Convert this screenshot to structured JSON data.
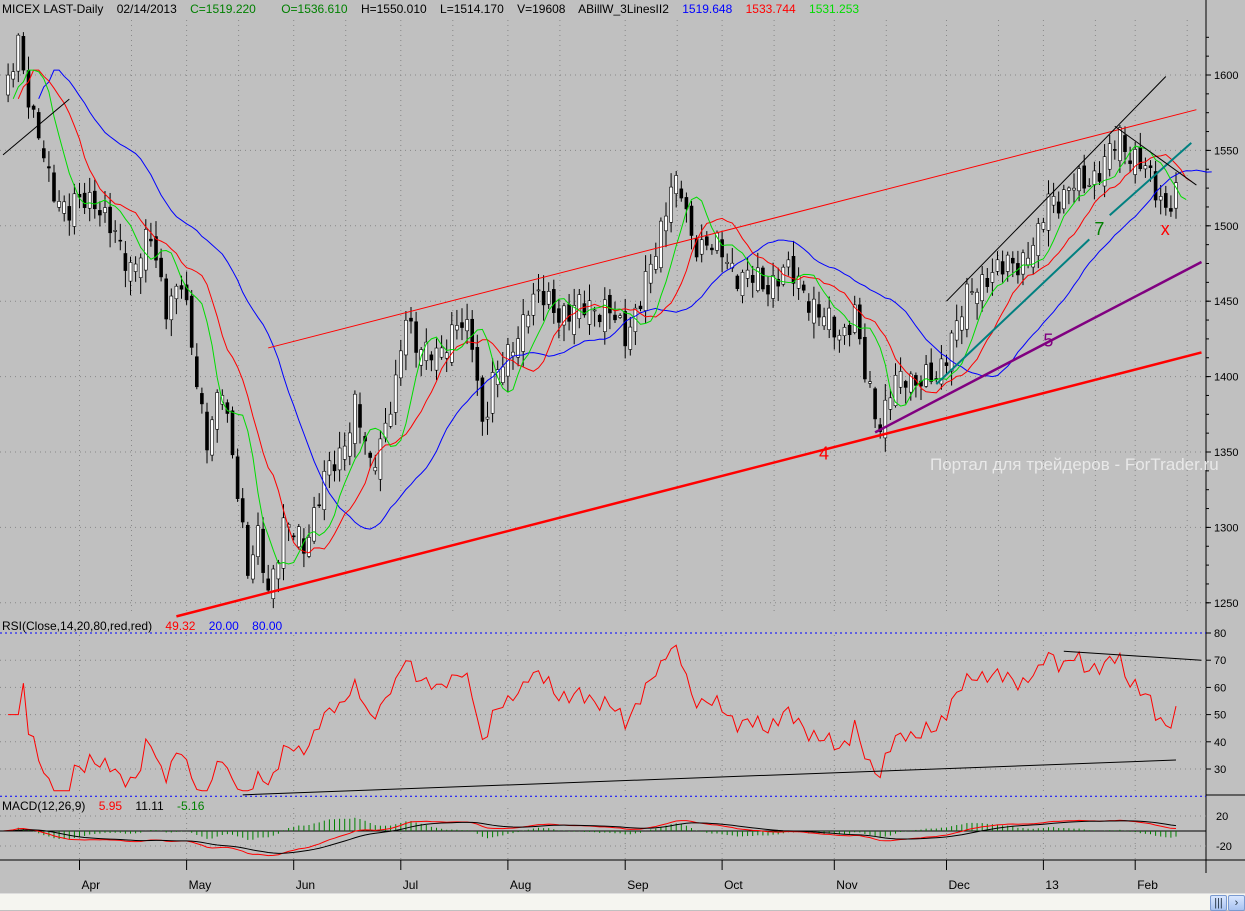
{
  "header": {
    "symbol": "MICEX LAST-Daily",
    "date": "02/14/2013",
    "close": "C=1519.220",
    "open": "O=1536.610",
    "high": "H=1550.010",
    "low": "L=1514.170",
    "volume": "V=19608",
    "indicator": "ABillW_3LinesII2",
    "line_blue": "1519.648",
    "line_red": "1533.744",
    "line_green": "1531.253"
  },
  "rsi_header": {
    "label": "RSI(Close,14,20,80,red,red)",
    "value": "49.32",
    "low": "20.00",
    "high": "80.00"
  },
  "macd_header": {
    "label": "MACD(12,26,9)",
    "macd": "5.95",
    "signal": "11.11",
    "hist": "-5.16"
  },
  "watermark": "Портал для трейдеров - ForTrader.ru",
  "colors": {
    "bg": "#c0c0c0",
    "up": "#ffffff",
    "down": "#000000",
    "blue": "#0000ff",
    "red": "#ff0000",
    "green": "#00dd00",
    "purple": "#800080",
    "teal": "#008080"
  },
  "chart_data": {
    "type": "candlestick",
    "title": "MICEX LAST-Daily",
    "bars": 231,
    "close_waypoints": [
      [
        0,
        1580
      ],
      [
        1,
        1590
      ],
      [
        3,
        1625
      ],
      [
        6,
        1570
      ],
      [
        9,
        1530
      ],
      [
        13,
        1510
      ],
      [
        18,
        1520
      ],
      [
        22,
        1490
      ],
      [
        25,
        1475
      ],
      [
        29,
        1490
      ],
      [
        32,
        1450
      ],
      [
        35,
        1460
      ],
      [
        38,
        1400
      ],
      [
        40,
        1360
      ],
      [
        43,
        1390
      ],
      [
        46,
        1330
      ],
      [
        48,
        1270
      ],
      [
        50,
        1290
      ],
      [
        52,
        1260
      ],
      [
        55,
        1300
      ],
      [
        59,
        1290
      ],
      [
        63,
        1330
      ],
      [
        66,
        1350
      ],
      [
        69,
        1380
      ],
      [
        72,
        1340
      ],
      [
        75,
        1370
      ],
      [
        77,
        1390
      ],
      [
        79,
        1440
      ],
      [
        82,
        1420
      ],
      [
        85,
        1410
      ],
      [
        89,
        1440
      ],
      [
        92,
        1420
      ],
      [
        94,
        1370
      ],
      [
        96,
        1400
      ],
      [
        99,
        1410
      ],
      [
        103,
        1450
      ],
      [
        107,
        1450
      ],
      [
        111,
        1440
      ],
      [
        115,
        1450
      ],
      [
        119,
        1440
      ],
      [
        122,
        1430
      ],
      [
        125,
        1450
      ],
      [
        127,
        1470
      ],
      [
        131,
        1530
      ],
      [
        133,
        1520
      ],
      [
        135,
        1490
      ],
      [
        138,
        1490
      ],
      [
        141,
        1480
      ],
      [
        144,
        1470
      ],
      [
        149,
        1460
      ],
      [
        153,
        1470
      ],
      [
        157,
        1460
      ],
      [
        160,
        1440
      ],
      [
        164,
        1430
      ],
      [
        167,
        1440
      ],
      [
        169,
        1400
      ],
      [
        172,
        1370
      ],
      [
        174,
        1390
      ],
      [
        177,
        1400
      ],
      [
        180,
        1400
      ],
      [
        183,
        1395
      ],
      [
        186,
        1430
      ],
      [
        189,
        1450
      ],
      [
        193,
        1470
      ],
      [
        196,
        1470
      ],
      [
        200,
        1480
      ],
      [
        203,
        1490
      ],
      [
        205,
        1520
      ],
      [
        208,
        1520
      ],
      [
        212,
        1530
      ],
      [
        216,
        1540
      ],
      [
        219,
        1560
      ],
      [
        222,
        1545
      ],
      [
        225,
        1530
      ],
      [
        228,
        1515
      ],
      [
        230,
        1519
      ]
    ],
    "price_axis": {
      "ticks": [
        "1600",
        "1550",
        "1500",
        "1450",
        "1400",
        "1350",
        "1300",
        "1250"
      ],
      "range": [
        1230,
        1650
      ]
    },
    "rsi_axis": {
      "ticks": [
        "80",
        "70",
        "60",
        "50",
        "40",
        "30"
      ]
    },
    "macd_axis": {
      "ticks": [
        "20",
        "-20"
      ]
    },
    "months": [
      {
        "label": "Apr",
        "bar": 15
      },
      {
        "label": "May",
        "bar": 36
      },
      {
        "label": "Jun",
        "bar": 57
      },
      {
        "label": "Jul",
        "bar": 78
      },
      {
        "label": "Aug",
        "bar": 99
      },
      {
        "label": "Sep",
        "bar": 122
      },
      {
        "label": "Oct",
        "bar": 141
      },
      {
        "label": "Nov",
        "bar": 163
      },
      {
        "label": "Dec",
        "bar": 185
      },
      {
        "label": "13",
        "bar": 204
      },
      {
        "label": "Feb",
        "bar": 222
      }
    ],
    "moving_averages": [
      {
        "name": "blue",
        "period": 20,
        "color": "#0000ff"
      },
      {
        "name": "red",
        "period": 10,
        "color": "#ff0000"
      },
      {
        "name": "green",
        "period": 5,
        "color": "#00dd00"
      }
    ],
    "trendlines": [
      {
        "name": "red-support-4",
        "color": "#ff0000",
        "width": 2.5,
        "from": [
          34,
          1241
        ],
        "to": [
          235,
          1416
        ]
      },
      {
        "name": "red-channel-top",
        "color": "#ff0000",
        "width": 1,
        "from": [
          52,
          1419
        ],
        "to": [
          234,
          1577
        ]
      },
      {
        "name": "purple-support-5",
        "color": "#800080",
        "width": 2.5,
        "from": [
          171,
          1363
        ],
        "to": [
          235,
          1476
        ]
      },
      {
        "name": "teal-support-a",
        "color": "#008080",
        "width": 2,
        "from": [
          183,
          1395
        ],
        "to": [
          213,
          1491
        ]
      },
      {
        "name": "teal-support-b",
        "color": "#008080",
        "width": 2,
        "from": [
          217,
          1507
        ],
        "to": [
          233,
          1555
        ]
      },
      {
        "name": "black-channel",
        "color": "#000000",
        "width": 1,
        "from": [
          185,
          1450
        ],
        "to": [
          228,
          1599
        ]
      },
      {
        "name": "black-topleft",
        "color": "#000000",
        "width": 1,
        "from": [
          0,
          1547
        ],
        "to": [
          13,
          1584
        ]
      },
      {
        "name": "black-descending",
        "color": "#000000",
        "width": 1,
        "from": [
          218,
          1566
        ],
        "to": [
          234,
          1527
        ]
      }
    ],
    "labels": [
      {
        "text": "4",
        "color": "#ff0000",
        "bar": 160,
        "price": 1345
      },
      {
        "text": "5",
        "color": "#800080",
        "bar": 204,
        "price": 1420
      },
      {
        "text": "7",
        "color": "#008000",
        "bar": 214,
        "price": 1494
      },
      {
        "text": "x",
        "color": "#ff0000",
        "bar": 227,
        "price": 1494
      }
    ],
    "rsi_trendlines": [
      {
        "name": "rsi-top",
        "from": [
          208,
          73.3
        ],
        "to": [
          235,
          70
        ]
      },
      {
        "name": "rsi-bottom",
        "from": [
          47,
          20.5
        ],
        "to": [
          230,
          33.3
        ]
      }
    ]
  }
}
